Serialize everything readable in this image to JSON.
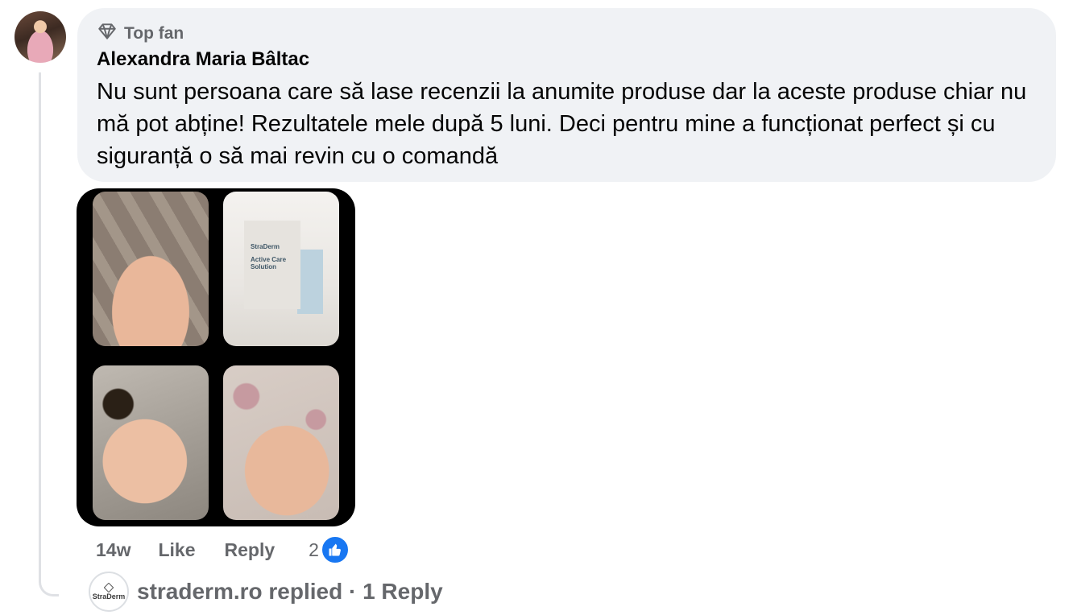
{
  "comment": {
    "badge": "Top fan",
    "author": "Alexandra Maria Bâltac",
    "text": "Nu sunt persoana care să lase recenzii la anumite produse dar la aceste produse chiar nu mă pot abține! Rezultatele mele după 5 luni. Deci pentru mine a funcționat perfect și cu siguranță o să mai revin cu o comandă",
    "time": "14w",
    "like_label": "Like",
    "reply_label": "Reply",
    "reaction_count": "2"
  },
  "photos": {
    "product_brand": "StraDerm",
    "product_name": "Active Care Solution"
  },
  "reply_summary": {
    "brand_avatar_text": "StraDerm",
    "text": "straderm.ro replied · 1 Reply"
  },
  "colors": {
    "bubble": "#f0f2f5",
    "secondary_text": "#65676b",
    "like_blue": "#1877f2"
  }
}
